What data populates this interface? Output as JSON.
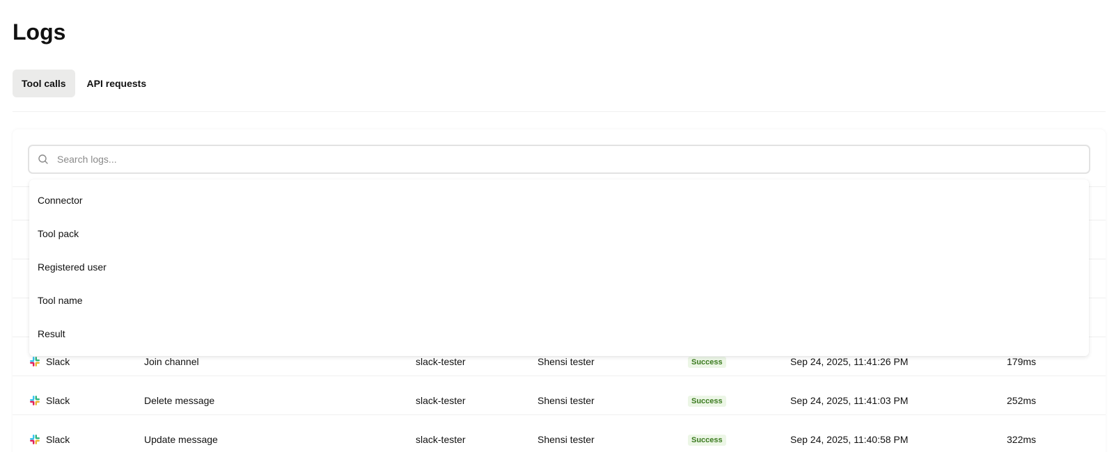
{
  "page": {
    "title": "Logs"
  },
  "tabs": [
    {
      "label": "Tool calls",
      "active": true
    },
    {
      "label": "API requests",
      "active": false
    }
  ],
  "search": {
    "placeholder": "Search logs...",
    "value": ""
  },
  "filter_menu": {
    "items": [
      "Connector",
      "Tool pack",
      "Registered user",
      "Tool name",
      "Result"
    ]
  },
  "table": {
    "rows": [
      {
        "connector": "Slack",
        "tool_name": "Join channel",
        "tool_pack": "slack-tester",
        "user": "Shensi tester",
        "result": "Success",
        "timestamp": "Sep 24, 2025, 11:41:26 PM",
        "duration": "179ms"
      },
      {
        "connector": "Slack",
        "tool_name": "Delete message",
        "tool_pack": "slack-tester",
        "user": "Shensi tester",
        "result": "Success",
        "timestamp": "Sep 24, 2025, 11:41:03 PM",
        "duration": "252ms"
      },
      {
        "connector": "Slack",
        "tool_name": "Update message",
        "tool_pack": "slack-tester",
        "user": "Shensi tester",
        "result": "Success",
        "timestamp": "Sep 24, 2025, 11:40:58 PM",
        "duration": "322ms"
      }
    ]
  },
  "colors": {
    "success_bg": "#ecf6e6",
    "success_text": "#3a7a1e",
    "tab_active_bg": "#ebebea"
  },
  "icons": {
    "search": "search-icon",
    "connector": "slack-icon"
  }
}
